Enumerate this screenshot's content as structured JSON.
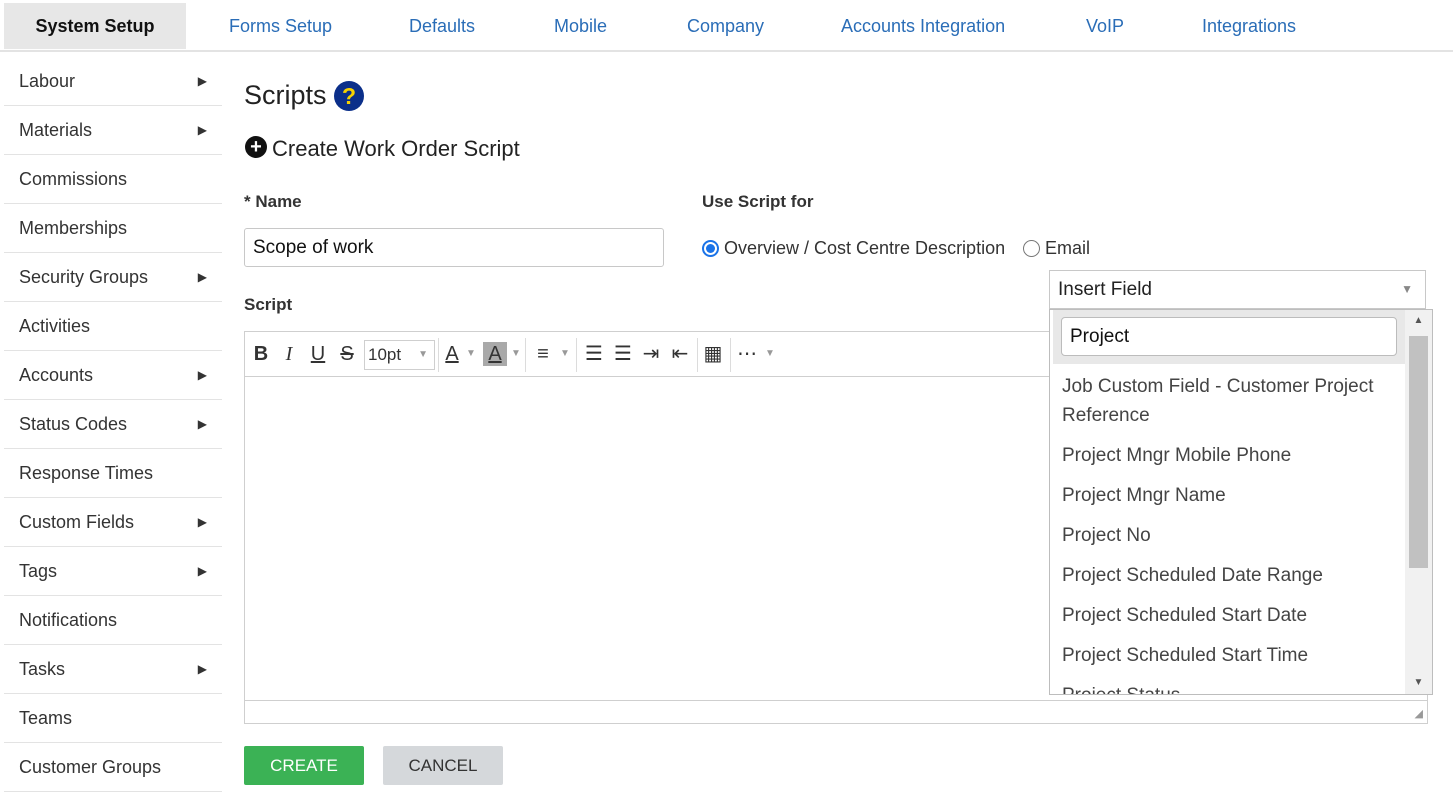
{
  "topnav": {
    "tabs": [
      {
        "label": "System Setup",
        "active": true
      },
      {
        "label": "Forms Setup"
      },
      {
        "label": "Defaults"
      },
      {
        "label": "Mobile"
      },
      {
        "label": "Company"
      },
      {
        "label": "Accounts Integration"
      },
      {
        "label": "VoIP"
      },
      {
        "label": "Integrations"
      }
    ]
  },
  "sidebar": {
    "items": [
      {
        "label": "Labour",
        "has_arrow": true
      },
      {
        "label": "Materials",
        "has_arrow": true
      },
      {
        "label": "Commissions",
        "has_arrow": false
      },
      {
        "label": "Memberships",
        "has_arrow": false
      },
      {
        "label": "Security Groups",
        "has_arrow": true
      },
      {
        "label": "Activities",
        "has_arrow": false
      },
      {
        "label": "Accounts",
        "has_arrow": true
      },
      {
        "label": "Status Codes",
        "has_arrow": true
      },
      {
        "label": "Response Times",
        "has_arrow": false
      },
      {
        "label": "Custom Fields",
        "has_arrow": true
      },
      {
        "label": "Tags",
        "has_arrow": true
      },
      {
        "label": "Notifications",
        "has_arrow": false
      },
      {
        "label": "Tasks",
        "has_arrow": true
      },
      {
        "label": "Teams",
        "has_arrow": false
      },
      {
        "label": "Customer Groups",
        "has_arrow": false
      }
    ],
    "arrow_glyph": "▶"
  },
  "main": {
    "title": "Scripts",
    "help_glyph": "?",
    "create_heading": "Create Work Order Script",
    "name_label": "* Name",
    "name_value": "Scope of work",
    "use_for_label": "Use Script for",
    "use_for_options": [
      {
        "label": "Overview / Cost Centre Description",
        "checked": true
      },
      {
        "label": "Email",
        "checked": false
      }
    ],
    "script_label": "Script",
    "font_size": "10pt",
    "insert_field": {
      "label": "Insert Field",
      "search_value": "Project",
      "options": [
        "Job Custom Field - Customer Project Reference",
        "Project Mngr Mobile Phone",
        "Project Mngr Name",
        "Project No",
        "Project Scheduled Date Range",
        "Project Scheduled Start Date",
        "Project Scheduled Start Time",
        "Project Status"
      ]
    },
    "buttons": {
      "create": "CREATE",
      "cancel": "CANCEL"
    }
  },
  "colors": {
    "link_blue": "#2a6db7",
    "create_green": "#3bb255",
    "cancel_gray": "#d5d8db",
    "help_blue": "#0b2f8a",
    "help_yellow": "#f6d100",
    "radio_blue": "#1a73e8"
  }
}
